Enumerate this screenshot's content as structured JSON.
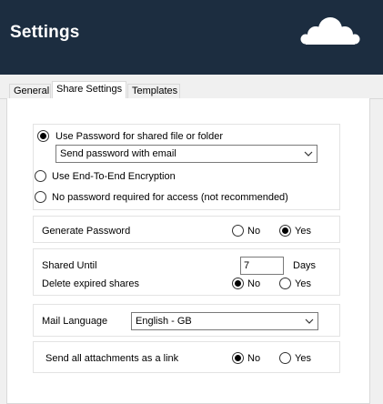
{
  "header": {
    "title": "Settings",
    "logo_icon": "cloud-logo-icon"
  },
  "tabs": [
    {
      "label": "General",
      "active": false
    },
    {
      "label": "Share Settings",
      "active": true
    },
    {
      "label": "Templates",
      "active": false
    }
  ],
  "password": {
    "option_use_password": "Use Password for shared file or folder",
    "method_selected": "Send password with email",
    "option_e2e": "Use End-To-End Encryption",
    "option_none": "No password required for access (not recommended)",
    "selected": "use_password"
  },
  "generate_password": {
    "label": "Generate Password",
    "no": "No",
    "yes": "Yes",
    "selected": "yes"
  },
  "shared_until": {
    "label": "Shared Until",
    "prefix": "+",
    "value": "7",
    "unit": "Days"
  },
  "delete_expired": {
    "label": "Delete expired shares",
    "no": "No",
    "yes": "Yes",
    "selected": "no"
  },
  "mail_language": {
    "label": "Mail Language",
    "selected": "English - GB"
  },
  "attachments": {
    "label": "Send all attachments as a link",
    "no": "No",
    "yes": "Yes",
    "selected": "no"
  },
  "colors": {
    "header_bg": "#1c2d40",
    "header_text": "#ffffff"
  }
}
